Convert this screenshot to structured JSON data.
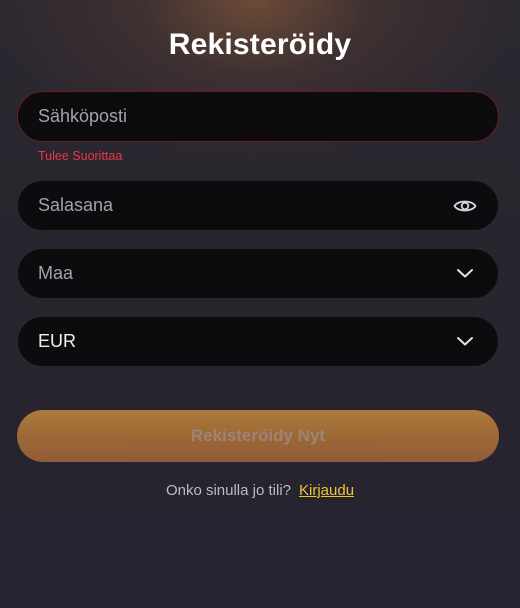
{
  "page": {
    "title": "Rekisteröidy"
  },
  "form": {
    "email": {
      "placeholder": "Sähköposti",
      "error": "Tulee Suorittaa"
    },
    "password": {
      "placeholder": "Salasana",
      "toggle_icon": "eye-icon"
    },
    "country": {
      "placeholder": "Maa",
      "icon": "chevron-down-icon"
    },
    "currency": {
      "selected": "EUR",
      "icon": "chevron-down-icon"
    },
    "submit_label": "Rekisteröidy Nyt"
  },
  "footer": {
    "question": "Onko sinulla jo tili?",
    "login_link": "Kirjaudu"
  },
  "colors": {
    "accent": "#f2c230",
    "error": "#e8364a",
    "button": "#c08440",
    "field_bg": "#0e0b0f"
  }
}
